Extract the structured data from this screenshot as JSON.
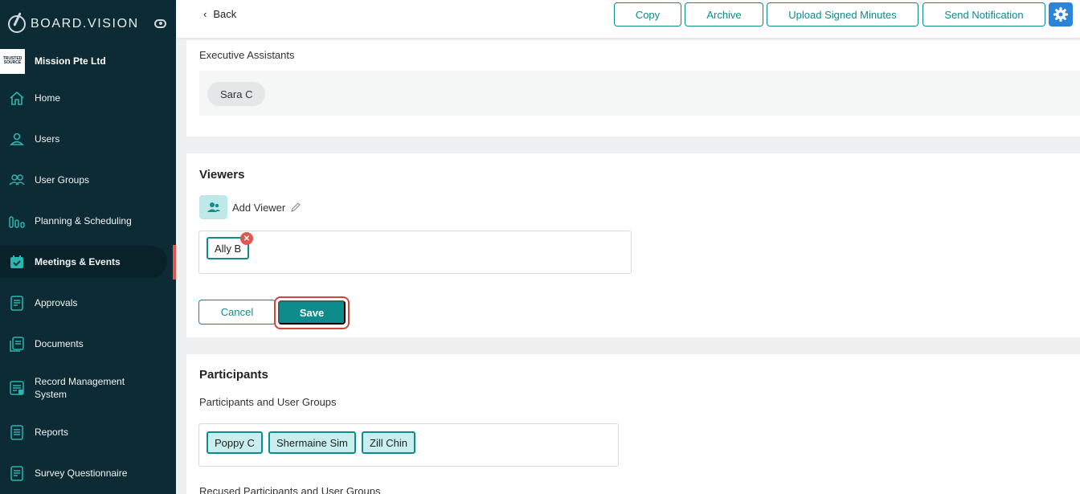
{
  "app": {
    "brand": "BOARD.VISION"
  },
  "org": {
    "logo_text": "TRUSTED SOURCE",
    "name": "Mission Pte Ltd"
  },
  "sidebar": {
    "items": [
      {
        "label": "Home",
        "icon": "home-icon"
      },
      {
        "label": "Users",
        "icon": "user-icon"
      },
      {
        "label": "User Groups",
        "icon": "users-icon"
      },
      {
        "label": "Planning & Scheduling",
        "icon": "planning-icon"
      },
      {
        "label": "Meetings & Events",
        "icon": "calendar-check-icon",
        "active": true
      },
      {
        "label": "Approvals",
        "icon": "approvals-icon"
      },
      {
        "label": "Documents",
        "icon": "documents-icon"
      },
      {
        "label": "Record Management System",
        "icon": "record-icon"
      },
      {
        "label": "Reports",
        "icon": "reports-icon"
      },
      {
        "label": "Survey Questionnaire",
        "icon": "survey-icon"
      }
    ]
  },
  "topbar": {
    "back_label": "Back",
    "buttons": [
      "Copy",
      "Archive",
      "Upload Signed Minutes",
      "Send Notification"
    ]
  },
  "executive_assistants": {
    "label": "Executive Assistants",
    "people": [
      "Sara C"
    ]
  },
  "viewers": {
    "title": "Viewers",
    "add_label": "Add Viewer",
    "selected": [
      "Ally B"
    ],
    "cancel_label": "Cancel",
    "save_label": "Save"
  },
  "participants": {
    "title": "Participants",
    "groups_label": "Participants and User Groups",
    "members": [
      "Poppy C",
      "Shermaine Sim",
      "Zill Chin"
    ],
    "recused_label": "Recused Participants and User Groups"
  },
  "colors": {
    "sidebar": "#0d2b34",
    "accent": "#0e8c8c",
    "danger": "#e0574f",
    "gear": "#2b84d8"
  }
}
